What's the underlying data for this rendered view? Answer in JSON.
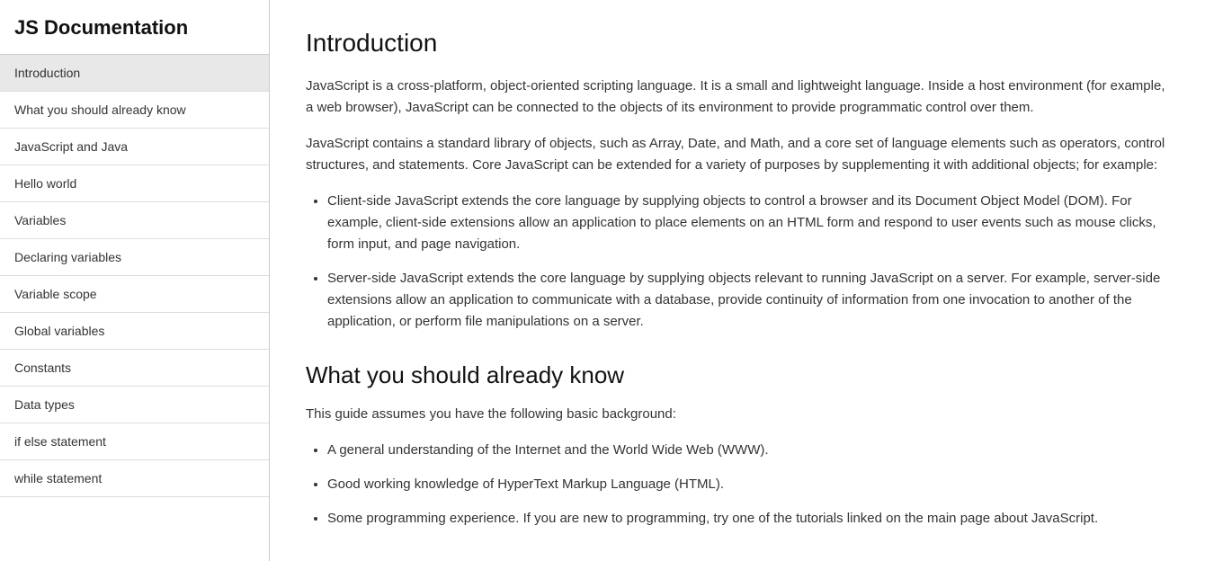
{
  "sidebar": {
    "title": "JS Documentation",
    "items": [
      {
        "label": "Introduction",
        "active": true
      },
      {
        "label": "What you should already know",
        "active": false
      },
      {
        "label": "JavaScript and Java",
        "active": false
      },
      {
        "label": "Hello world",
        "active": false
      },
      {
        "label": "Variables",
        "active": false
      },
      {
        "label": "Declaring variables",
        "active": false
      },
      {
        "label": "Variable scope",
        "active": false
      },
      {
        "label": "Global variables",
        "active": false
      },
      {
        "label": "Constants",
        "active": false
      },
      {
        "label": "Data types",
        "active": false
      },
      {
        "label": "if else statement",
        "active": false
      },
      {
        "label": "while statement",
        "active": false
      }
    ]
  },
  "main": {
    "intro": {
      "title": "Introduction",
      "para1": "JavaScript is a cross-platform, object-oriented scripting language. It is a small and lightweight language. Inside a host environment (for example, a web browser), JavaScript can be connected to the objects of its environment to provide programmatic control over them.",
      "para2": "JavaScript contains a standard library of objects, such as Array, Date, and Math, and a core set of language elements such as operators, control structures, and statements. Core JavaScript can be extended for a variety of purposes by supplementing it with additional objects; for example:",
      "bullets": [
        "Client-side JavaScript extends the core language by supplying objects to control a browser and its Document Object Model (DOM). For example, client-side extensions allow an application to place elements on an HTML form and respond to user events such as mouse clicks, form input, and page navigation.",
        "Server-side JavaScript extends the core language by supplying objects relevant to running JavaScript on a server. For example, server-side extensions allow an application to communicate with a database, provide continuity of information from one invocation to another of the application, or perform file manipulations on a server."
      ]
    },
    "whatYouShouldKnow": {
      "title": "What you should already know",
      "intro": "This guide assumes you have the following basic background:",
      "bullets": [
        "A general understanding of the Internet and the World Wide Web (WWW).",
        "Good working knowledge of HyperText Markup Language (HTML).",
        "Some programming experience. If you are new to programming, try one of the tutorials linked on the main page about JavaScript."
      ]
    }
  }
}
